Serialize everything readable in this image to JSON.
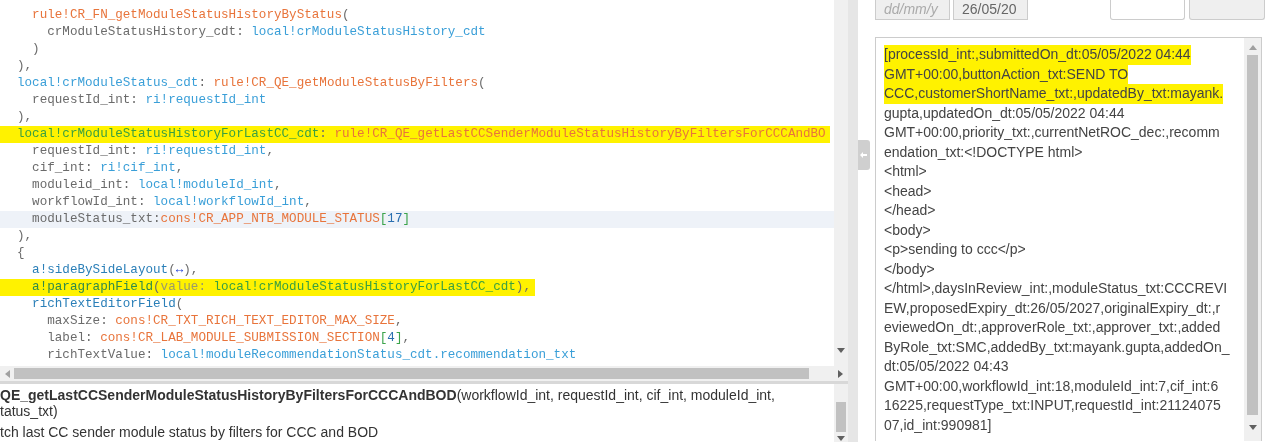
{
  "editor": {
    "lines": [
      {
        "highlighted": false,
        "current": false,
        "tokens": [
          {
            "kind": "rule",
            "text": "  rule!CR_FN_getModuleStatusHistoryByStatus"
          },
          {
            "kind": "plain",
            "text": "("
          }
        ]
      },
      {
        "highlighted": false,
        "current": false,
        "tokens": [
          {
            "kind": "plain",
            "text": "    crModuleStatusHistory_cdt: "
          },
          {
            "kind": "var",
            "text": "local!crModuleStatusHistory_cdt"
          }
        ]
      },
      {
        "highlighted": false,
        "current": false,
        "tokens": [
          {
            "kind": "plain",
            "text": "  )"
          }
        ]
      },
      {
        "highlighted": false,
        "current": false,
        "tokens": [
          {
            "kind": "plain",
            "text": "),"
          }
        ]
      },
      {
        "highlighted": false,
        "current": false,
        "tokens": [
          {
            "kind": "var",
            "text": "local!crModuleStatus_cdt"
          },
          {
            "kind": "plain",
            "text": ": "
          },
          {
            "kind": "rule",
            "text": "rule!CR_QE_getModuleStatusByFilters"
          },
          {
            "kind": "plain",
            "text": "("
          }
        ]
      },
      {
        "highlighted": false,
        "current": false,
        "tokens": [
          {
            "kind": "plain",
            "text": "  requestId_int: "
          },
          {
            "kind": "var",
            "text": "ri!requestId_int"
          }
        ]
      },
      {
        "highlighted": false,
        "current": false,
        "tokens": [
          {
            "kind": "plain",
            "text": "),"
          }
        ]
      },
      {
        "highlighted": true,
        "current": false,
        "tokens": [
          {
            "kind": "var",
            "text": "local!crModuleStatusHistoryForLastCC_cdt"
          },
          {
            "kind": "plain",
            "text": ": "
          },
          {
            "kind": "rule",
            "text": "rule!CR_QE_getLastCCSenderModuleStatusHistoryByFiltersForCCCAndBO"
          }
        ]
      },
      {
        "highlighted": false,
        "current": false,
        "tokens": [
          {
            "kind": "plain",
            "text": "  requestId_int: "
          },
          {
            "kind": "var",
            "text": "ri!requestId_int"
          },
          {
            "kind": "plain",
            "text": ","
          }
        ]
      },
      {
        "highlighted": false,
        "current": false,
        "tokens": [
          {
            "kind": "plain",
            "text": "  cif_int: "
          },
          {
            "kind": "var",
            "text": "ri!cif_int"
          },
          {
            "kind": "plain",
            "text": ","
          }
        ]
      },
      {
        "highlighted": false,
        "current": false,
        "tokens": [
          {
            "kind": "plain",
            "text": "  moduleid_int: "
          },
          {
            "kind": "var",
            "text": "local!moduleId_int"
          },
          {
            "kind": "plain",
            "text": ","
          }
        ]
      },
      {
        "highlighted": false,
        "current": false,
        "tokens": [
          {
            "kind": "plain",
            "text": "  workflowId_int: "
          },
          {
            "kind": "var",
            "text": "local!workflowId_int"
          },
          {
            "kind": "plain",
            "text": ","
          }
        ]
      },
      {
        "highlighted": false,
        "current": true,
        "tokens": [
          {
            "kind": "plain",
            "text": "  moduleStatus_txt:"
          },
          {
            "kind": "rule",
            "text": "cons!CR_APP_NTB_MODULE_STATUS"
          },
          {
            "kind": "bracket",
            "text": "["
          },
          {
            "kind": "number",
            "text": "17"
          },
          {
            "kind": "bracket",
            "text": "]"
          }
        ]
      },
      {
        "highlighted": false,
        "current": false,
        "tokens": [
          {
            "kind": "plain",
            "text": "),"
          }
        ]
      },
      {
        "highlighted": false,
        "current": false,
        "tokens": [
          {
            "kind": "plain",
            "text": "{"
          }
        ]
      },
      {
        "highlighted": false,
        "current": false,
        "tokens": [
          {
            "kind": "func",
            "text": "  a!sideBySideLayout"
          },
          {
            "kind": "plain",
            "text": "("
          },
          {
            "kind": "symbol",
            "text": "↔"
          },
          {
            "kind": "plain",
            "text": "),"
          }
        ]
      },
      {
        "highlighted": true,
        "current": false,
        "tokens": [
          {
            "kind": "func",
            "text": "  a!paragraphField"
          },
          {
            "kind": "plain",
            "text": "("
          },
          {
            "kind": "key",
            "text": "value: "
          },
          {
            "kind": "var",
            "text": "local!crModuleStatusHistoryForLastCC_cdt"
          },
          {
            "kind": "plain",
            "text": "),"
          }
        ]
      },
      {
        "highlighted": false,
        "current": false,
        "tokens": [
          {
            "kind": "func",
            "text": "  richTextEditorField"
          },
          {
            "kind": "plain",
            "text": "("
          }
        ]
      },
      {
        "highlighted": false,
        "current": false,
        "tokens": [
          {
            "kind": "plain",
            "text": "    maxSize: "
          },
          {
            "kind": "rule",
            "text": "cons!CR_TXT_RICH_TEXT_EDITOR_MAX_SIZE"
          },
          {
            "kind": "plain",
            "text": ","
          }
        ]
      },
      {
        "highlighted": false,
        "current": false,
        "tokens": [
          {
            "kind": "plain",
            "text": "    label: "
          },
          {
            "kind": "rule",
            "text": "cons!CR_LAB_MODULE_SUBMISSION_SECTION"
          },
          {
            "kind": "bracket",
            "text": "["
          },
          {
            "kind": "number",
            "text": "4"
          },
          {
            "kind": "bracket",
            "text": "]"
          },
          {
            "kind": "plain",
            "text": ","
          }
        ]
      },
      {
        "highlighted": false,
        "current": false,
        "tokens": [
          {
            "kind": "plain",
            "text": "    richTextValue: "
          },
          {
            "kind": "var",
            "text": "local!moduleRecommendationStatus_cdt.recommendation_txt"
          }
        ]
      }
    ]
  },
  "doc_panel": {
    "signature_lines": [
      "**QE_getLastCCSenderModuleStatusHistoryByFiltersForCCCAndBOD**(workflowId_int, requestId_int, cif_int, moduleId_int,",
      "tatus_txt)"
    ],
    "description": "tch last CC sender module status by filters for CCC and BOD"
  },
  "right_panel": {
    "fields": [
      {
        "kind": "date",
        "placeholder": "dd/mm/y",
        "disabled": true
      },
      {
        "kind": "date",
        "value": "26/05/20",
        "disabled": true
      },
      {
        "kind": "text",
        "disabled": false
      },
      {
        "kind": "text",
        "disabled": true
      }
    ],
    "textarea": {
      "lines": [
        {
          "text": "[processId_int:,submittedOn_dt:05/05/2022 04:44",
          "highlighted": true
        },
        {
          "text": "GMT+00:00,buttonAction_txt:SEND TO",
          "highlighted": true
        },
        {
          "text": "CCC,customerShortName_txt:,updatedBy_txt:mayank.",
          "highlighted": true
        },
        {
          "text": "gupta,updatedOn_dt:05/05/2022 04:44",
          "highlighted": false
        },
        {
          "text": "GMT+00:00,priority_txt:,currentNetROC_dec:,recomm",
          "highlighted": false
        },
        {
          "text": "endation_txt:<!DOCTYPE html>",
          "highlighted": false
        },
        {
          "text": "<html>",
          "highlighted": false
        },
        {
          "text": "<head>",
          "highlighted": false
        },
        {
          "text": "</head>",
          "highlighted": false
        },
        {
          "text": "<body>",
          "highlighted": false
        },
        {
          "text": "<p>sending to ccc</p>",
          "highlighted": false
        },
        {
          "text": "</body>",
          "highlighted": false
        },
        {
          "text": "</html>,daysInReview_int:,moduleStatus_txt:CCCREVI",
          "highlighted": false
        },
        {
          "text": "EW,proposedExpiry_dt:26/05/2027,originalExpiry_dt:,r",
          "highlighted": false
        },
        {
          "text": "eviewedOn_dt:,approverRole_txt:,approver_txt:,added",
          "highlighted": false
        },
        {
          "text": "ByRole_txt:SMC,addedBy_txt:mayank.gupta,addedOn_",
          "highlighted": false
        },
        {
          "text": "dt:05/05/2022 04:43",
          "highlighted": false
        },
        {
          "text": "GMT+00:00,workflowId_int:18,moduleId_int:7,cif_int:6",
          "highlighted": false
        },
        {
          "text": "16225,requestType_txt:INPUT,requestId_int:21124075",
          "highlighted": false
        },
        {
          "text": "07,id_int:990981]",
          "highlighted": false
        }
      ]
    }
  }
}
